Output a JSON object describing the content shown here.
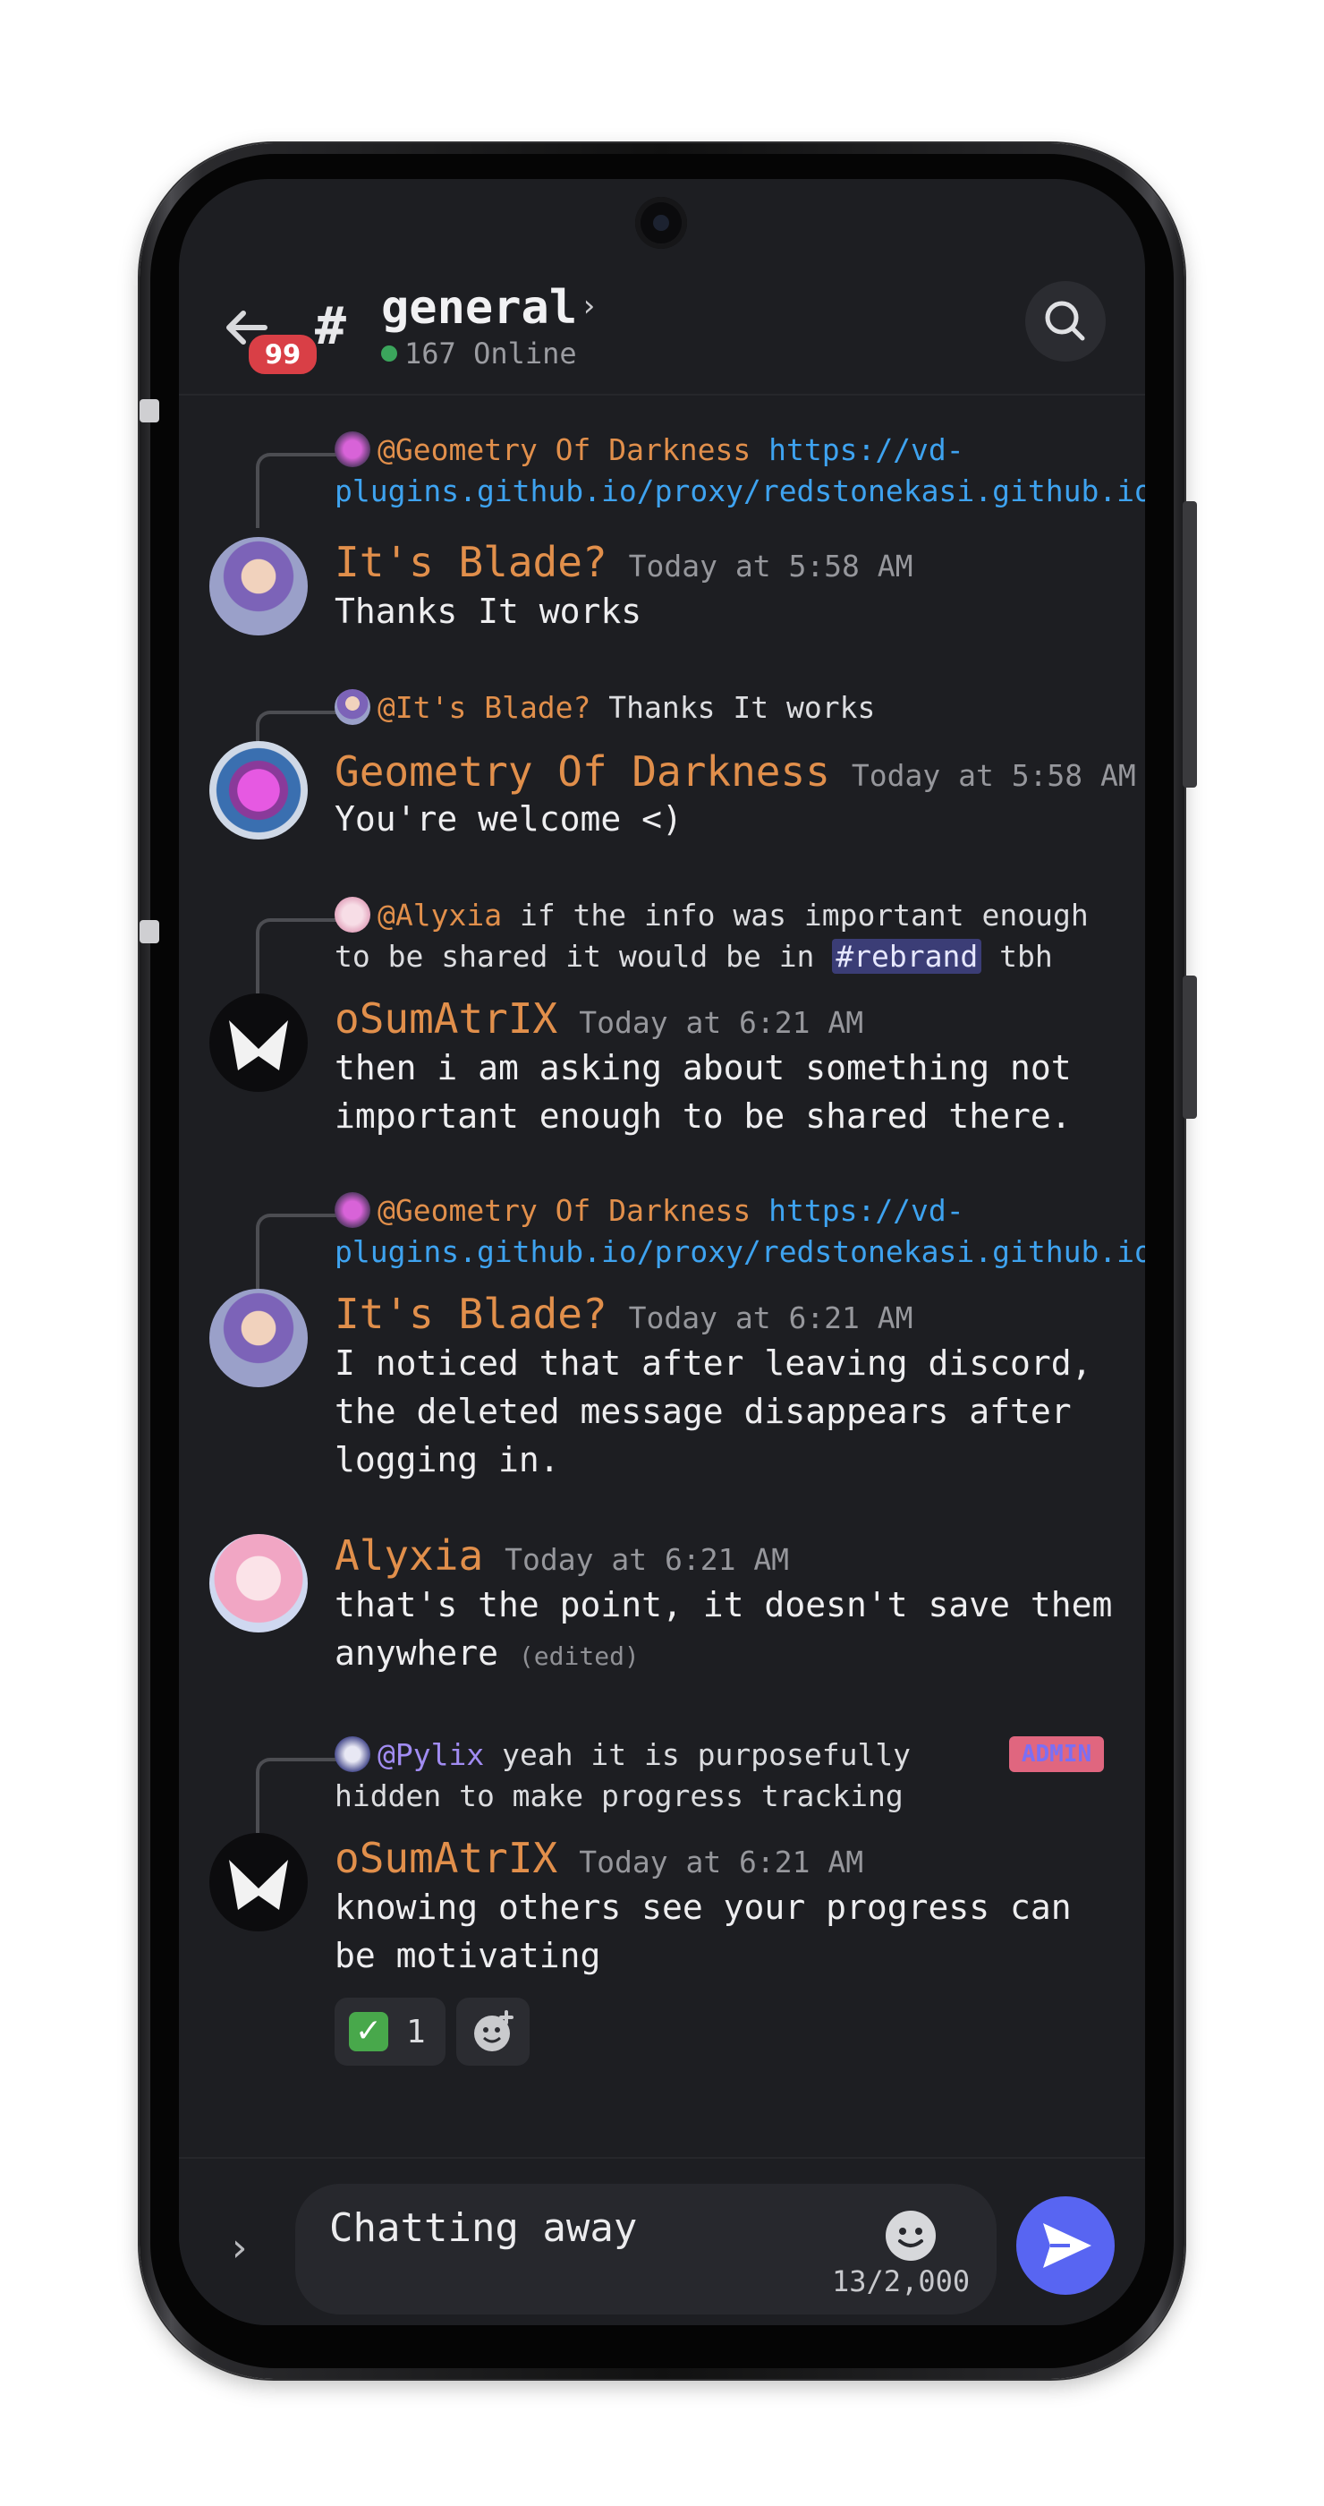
{
  "header": {
    "unread_badge": "99",
    "channel_hash": "#",
    "channel_name": "general",
    "channel_chevron": "›",
    "online_count": "167 Online"
  },
  "messages": [
    {
      "reply": {
        "mention": "@Geometry Of Darkness",
        "text": "https://vd-plugins.github.io/proxy/redstonekasi.github.io"
      },
      "author": "It's Blade?",
      "timestamp": "Today at 5:58 AM",
      "text": "Thanks It works"
    },
    {
      "reply": {
        "mention": "@It's Blade?",
        "text": "Thanks It works"
      },
      "author": "Geometry Of Darkness",
      "timestamp": "Today at 5:58 AM",
      "text": "You're welcome <)"
    },
    {
      "reply": {
        "mention": "@Alyxia",
        "text_before": "if the info was important enough to be shared it would be in",
        "channel": "#rebrand",
        "text_after": "tbh"
      },
      "author": "oSumAtrIX",
      "timestamp": "Today at 6:21 AM",
      "text": "then i am asking about something not important enough to be shared there."
    },
    {
      "reply": {
        "mention": "@Geometry Of Darkness",
        "text": "https://vd-plugins.github.io/proxy/redstonekasi.github.io"
      },
      "author": "It's Blade?",
      "timestamp": "Today at 6:21 AM",
      "text": "I noticed that after leaving discord, the deleted message disappears after logging in."
    },
    {
      "author": "Alyxia",
      "timestamp": "Today at 6:21 AM",
      "text": "that's the point, it doesn't save them anywhere",
      "edited": "(edited)"
    },
    {
      "reply": {
        "mention": "@Pylix",
        "text": "yeah it is purposefully hidden to make progress tracking",
        "role": "ADMIN"
      },
      "author": "oSumAtrIX",
      "timestamp": "Today at 6:21 AM",
      "text": "knowing others see your progress can be motivating",
      "reaction": {
        "emoji": "✓",
        "count": "1"
      }
    }
  ],
  "composer": {
    "expand_icon": "›",
    "draft_text": "Chatting away",
    "char_counter": "13/2,000"
  },
  "icons": [
    "back-arrow-icon",
    "chevron-right-icon",
    "search-icon",
    "emoji-icon",
    "add-reaction-icon",
    "send-icon"
  ],
  "colors": {
    "background": "#1d1e22",
    "username": "#e18f4b",
    "link": "#3ea3f0",
    "online": "#3ba55c",
    "badge": "#d93f46",
    "send": "#5865f2",
    "admin_tag": "#e0667f"
  }
}
